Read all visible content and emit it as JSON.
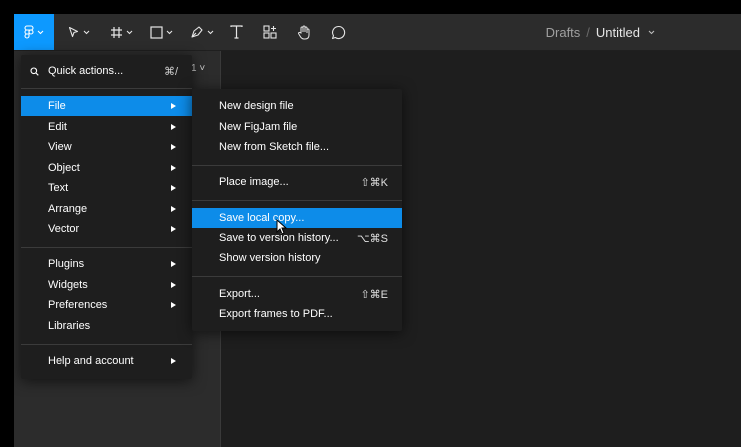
{
  "toolbar": {
    "breadcrumb": "Drafts",
    "separator": "/",
    "title": "Untitled"
  },
  "left_panel": {
    "page_indicator": "1 ˅"
  },
  "main_menu": {
    "quick_actions": {
      "label": "Quick actions...",
      "shortcut": "⌘/"
    },
    "items": [
      {
        "label": "File"
      },
      {
        "label": "Edit"
      },
      {
        "label": "View"
      },
      {
        "label": "Object"
      },
      {
        "label": "Text"
      },
      {
        "label": "Arrange"
      },
      {
        "label": "Vector"
      },
      {
        "label": "Plugins"
      },
      {
        "label": "Widgets"
      },
      {
        "label": "Preferences"
      },
      {
        "label": "Libraries"
      },
      {
        "label": "Help and account"
      }
    ]
  },
  "file_menu": {
    "items": [
      {
        "label": "New design file",
        "shortcut": ""
      },
      {
        "label": "New FigJam file",
        "shortcut": ""
      },
      {
        "label": "New from Sketch file...",
        "shortcut": ""
      },
      {
        "label": "Place image...",
        "shortcut": "⇧⌘K"
      },
      {
        "label": "Save local copy...",
        "shortcut": ""
      },
      {
        "label": "Save to version history...",
        "shortcut": "⌥⌘S"
      },
      {
        "label": "Show version history",
        "shortcut": ""
      },
      {
        "label": "Export...",
        "shortcut": "⇧⌘E"
      },
      {
        "label": "Export frames to PDF...",
        "shortcut": ""
      }
    ]
  },
  "colors": {
    "accent": "#0d99ff",
    "highlight": "#0d8ce9",
    "menu_bg": "#1e1e1e",
    "toolbar_bg": "#2c2c2c"
  }
}
